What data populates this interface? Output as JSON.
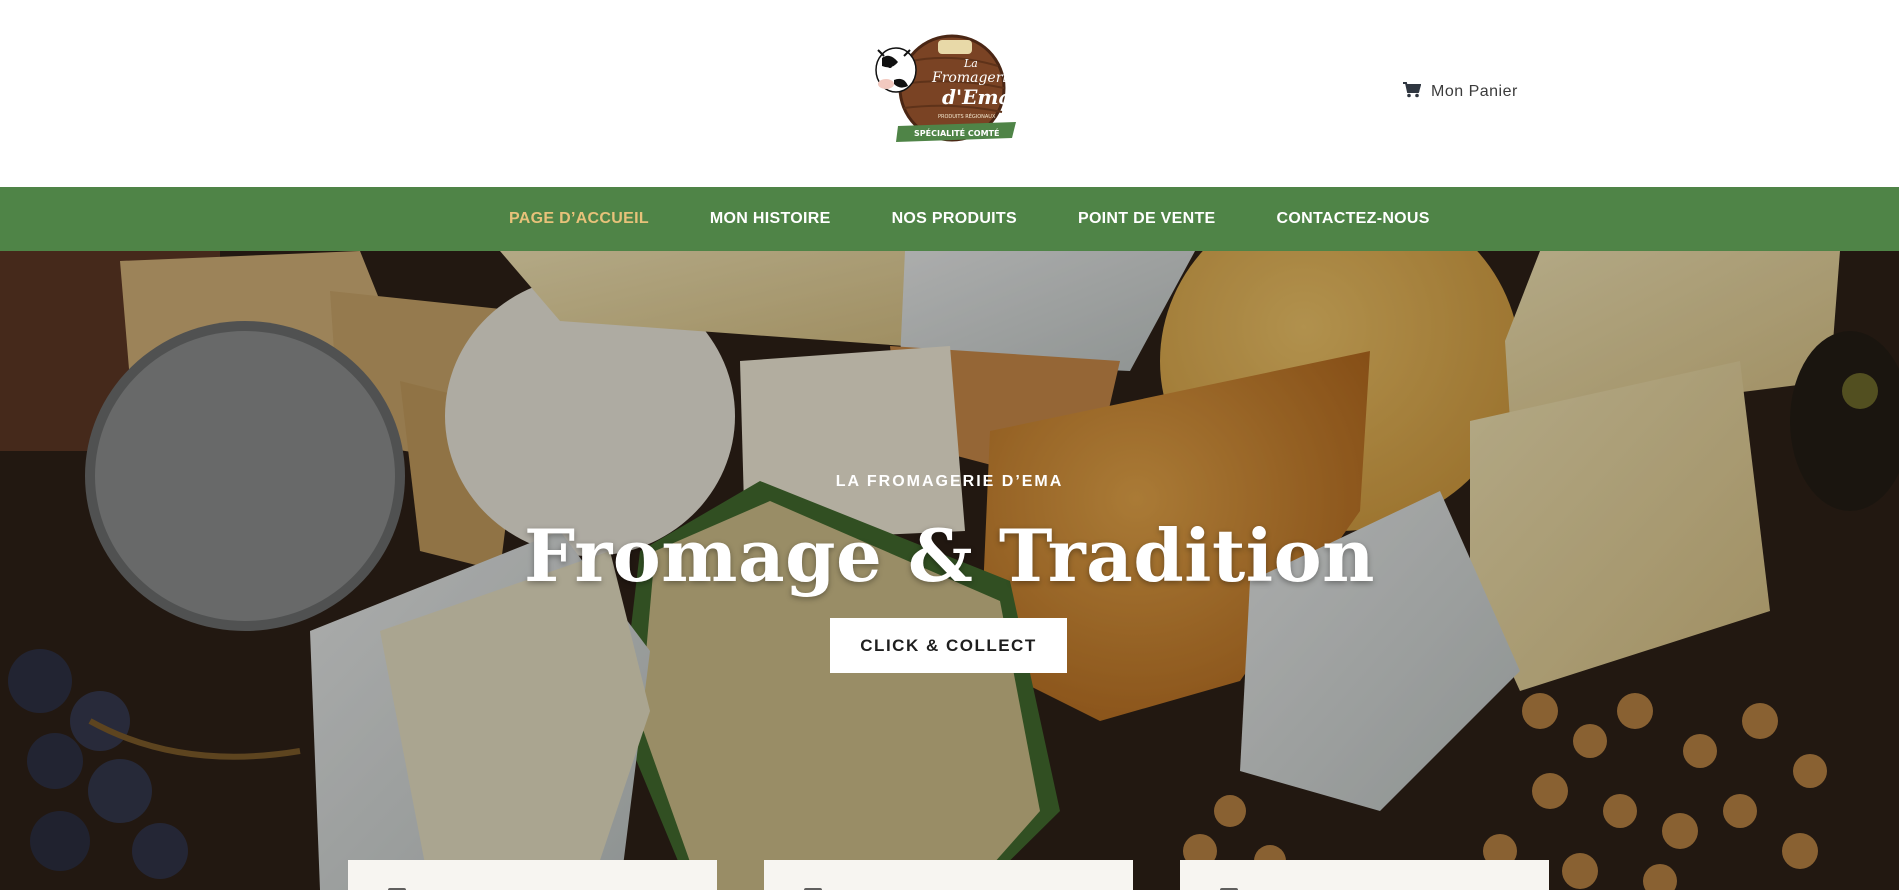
{
  "header": {
    "logo": {
      "name_line1": "La",
      "name_line2": "Fromagerie",
      "name_line3": "d'Ema",
      "tagline": "PRODUITS RÉGIONAUX",
      "ribbon": "SPÉCIALITÉ COMTÉ"
    },
    "cart": {
      "label": "Mon Panier",
      "icon": "shopping-cart-icon"
    }
  },
  "nav": {
    "items": [
      {
        "label": "PAGE D’ACCUEIL",
        "active": true
      },
      {
        "label": "MON HISTOIRE",
        "active": false
      },
      {
        "label": "NOS PRODUITS",
        "active": false
      },
      {
        "label": "POINT DE VENTE",
        "active": false
      },
      {
        "label": "CONTACTEZ-NOUS",
        "active": false
      }
    ]
  },
  "hero": {
    "eyebrow": "LA FROMAGERIE D’EMA",
    "title": "Fromage & Tradition",
    "cta_label": "CLICK & COLLECT"
  },
  "colors": {
    "nav_bg": "#4f8447",
    "nav_active": "#e8c27a",
    "logo_wood": "#7a4324",
    "logo_green": "#4f8447"
  }
}
